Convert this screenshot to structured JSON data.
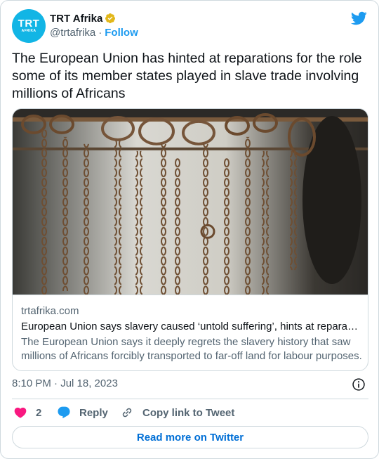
{
  "author": {
    "display_name": "TRT Afrika",
    "handle": "@trtafrika",
    "separator": "·",
    "follow_label": "Follow",
    "avatar_text_big": "TRT",
    "avatar_text_small": "AFRIKA",
    "avatar_color": "#12b5e5",
    "verified_color": "#e2b719"
  },
  "tweet": {
    "text": "The European Union has hinted at reparations for the role some of its member states played in slave trade involving millions of Africans",
    "timestamp": "8:10 PM · Jul 18, 2023"
  },
  "link_card": {
    "domain": "trtafrika.com",
    "title": "European Union says slavery caused ‘untold suffering’, hints at reparations",
    "description": "The European Union says it deeply regrets the slavery history that saw millions of Africans forcibly transported to far-off land for labour purposes.",
    "image_icon": "chains-photo"
  },
  "actions": {
    "like_count": "2",
    "reply_label": "Reply",
    "copy_label": "Copy link to Tweet",
    "read_more_label": "Read more on Twitter"
  },
  "colors": {
    "accent": "#1d9bf0",
    "like": "#f91880",
    "read_more": "#006fd6",
    "muted": "#536471",
    "border": "#cfd9de"
  }
}
